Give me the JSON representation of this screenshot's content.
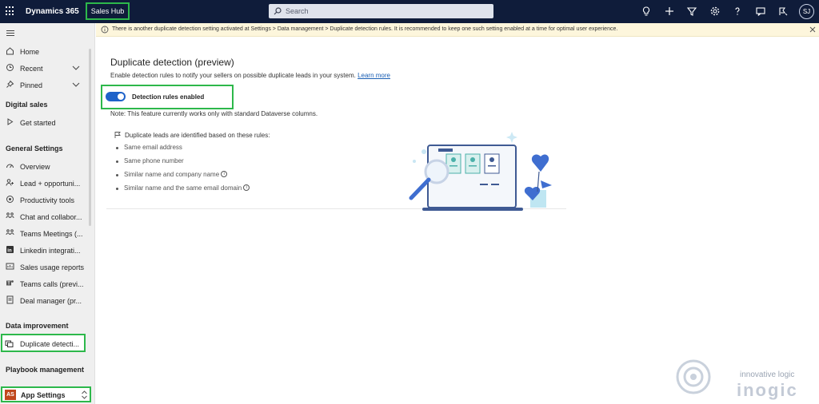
{
  "topbar": {
    "app_name": "Dynamics 365",
    "hub_name": "Sales Hub",
    "search_placeholder": "Search",
    "avatar_initials": "SJ"
  },
  "sidebar": {
    "home": "Home",
    "recent": "Recent",
    "pinned": "Pinned",
    "section_digital_sales": "Digital sales",
    "get_started": "Get started",
    "section_general_settings": "General Settings",
    "items": [
      "Overview",
      "Lead + opportuni...",
      "Productivity tools",
      "Chat and collabor...",
      "Teams Meetings (...",
      "Linkedin integrati...",
      "Sales usage reports",
      "Teams calls (previ...",
      "Deal manager (pr..."
    ],
    "section_data_improvement": "Data improvement",
    "duplicate_detection": "Duplicate detecti...",
    "section_playbook": "Playbook management",
    "app_settings_badge": "AS",
    "app_settings": "App Settings"
  },
  "banner": {
    "text": "There is another duplicate detection setting activated at Settings > Data management > Duplicate detection rules. It is recommended to keep one such setting enabled at a time for optimal user experience."
  },
  "main": {
    "title": "Duplicate detection (preview)",
    "description": "Enable detection rules to notify your sellers on possible duplicate leads in your system.",
    "learn_more": "Learn more",
    "toggle_label": "Detection rules enabled",
    "toggle_on": true,
    "note": "Note: This feature currently works only with standard Dataverse columns.",
    "rules_heading": "Duplicate leads are identified based on these rules:",
    "rules": [
      "Same email address",
      "Same phone number",
      "Similar name and company name",
      "Similar name and the same email domain"
    ]
  },
  "watermark": {
    "tagline": "innovative logic",
    "brand": "inogic"
  },
  "colors": {
    "topbar": "#0f1c3a",
    "highlight": "#2db84b",
    "toggle": "#1e62c9",
    "banner": "#fdf6dc"
  }
}
